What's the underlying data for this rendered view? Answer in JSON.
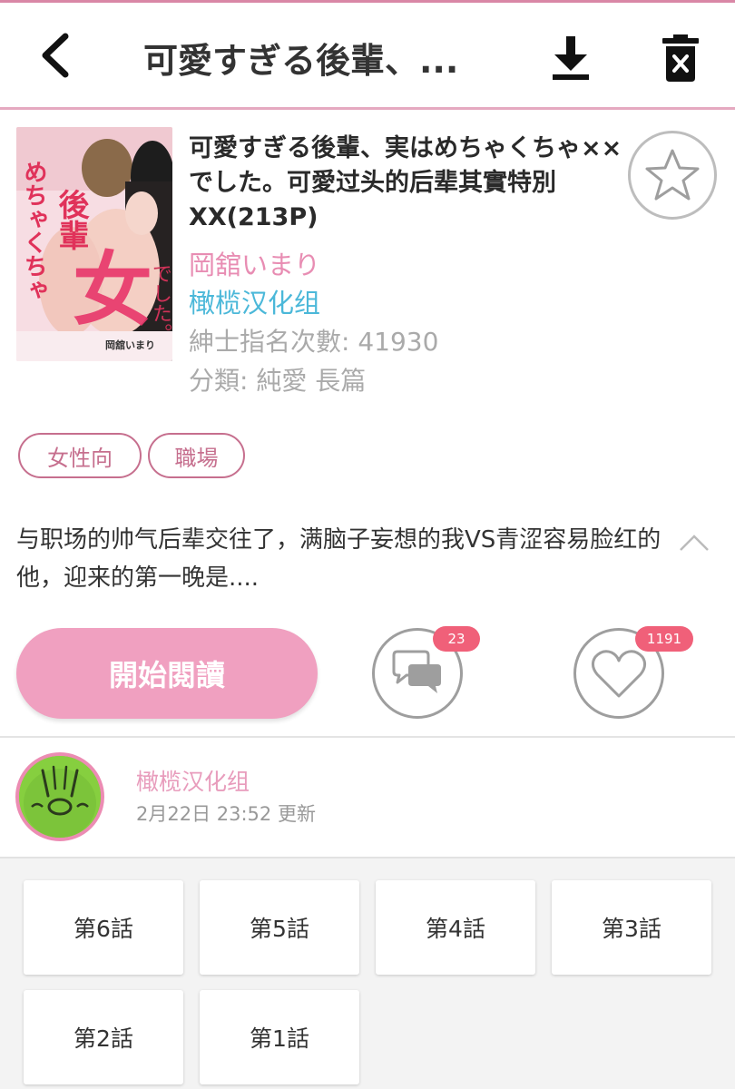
{
  "header": {
    "title": "可愛すぎる後輩、..."
  },
  "comic": {
    "title": "可愛すぎる後輩、実はめちゃくちゃ××でした。可愛过头的后辈其實特別XX(213P)",
    "author": "岡舘いまり",
    "group": "橄榄汉化组",
    "views": "紳士指名次數: 41930",
    "category": "分類: 純愛 長篇",
    "cover_text": {
      "title_vertical": "めちゃくちゃ",
      "title_big": "女",
      "title_small": "後輩",
      "suffix": "でした。",
      "author_stamp": "岡舘いまり"
    }
  },
  "tags": [
    "女性向",
    "職場"
  ],
  "description": "与职场的帅气后辈交往了，满脑子妄想的我VS青涩容易脸红的他，迎来的第一晚是....",
  "actions": {
    "read_label": "開始閱讀",
    "comments_count": "23",
    "likes_count": "1191"
  },
  "uploader": {
    "name": "橄榄汉化组",
    "updated": "2月22日 23:52 更新"
  },
  "chapters": [
    "第6話",
    "第5話",
    "第4話",
    "第3話",
    "第2話",
    "第1話"
  ],
  "colors": {
    "accent": "#e88db3",
    "read_button": "#f0a0c0",
    "group_link": "#4bb8d9",
    "badge": "#f06079",
    "tag_border": "#c66f8e"
  },
  "icons": {
    "back": "back-arrow-icon",
    "download": "download-icon",
    "delete": "delete-icon",
    "favorite": "star-icon",
    "comments": "comment-icon",
    "likes": "heart-icon",
    "collapse": "chevron-up-icon"
  }
}
